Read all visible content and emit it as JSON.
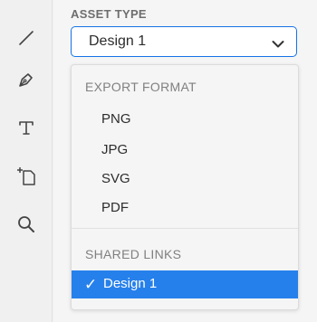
{
  "tools": [
    {
      "icon": "line-tool-icon"
    },
    {
      "icon": "pen-tool-icon"
    },
    {
      "icon": "text-tool-icon"
    },
    {
      "icon": "artboard-tool-icon"
    },
    {
      "icon": "zoom-tool-icon"
    }
  ],
  "asset_type": {
    "label": "ASSET TYPE",
    "selected_value": "Design 1"
  },
  "dropdown": {
    "export_format_header": "EXPORT FORMAT",
    "export_formats": [
      "PNG",
      "JPG",
      "SVG",
      "PDF"
    ],
    "shared_links_header": "SHARED LINKS",
    "shared_links": [
      {
        "label": "Design 1",
        "selected": true,
        "check": "✓"
      }
    ]
  },
  "colors": {
    "accent": "#1473e6",
    "selection": "#2680eb"
  }
}
